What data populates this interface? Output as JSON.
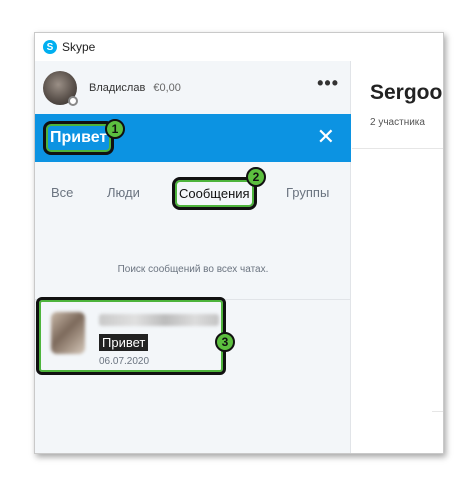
{
  "window": {
    "title": "Skype",
    "logo_letter": "S"
  },
  "profile": {
    "name": "Владислав",
    "balance": "€0,00",
    "more": "•••"
  },
  "search": {
    "query": "Привет",
    "close": "✕"
  },
  "tabs": [
    {
      "label": "Все"
    },
    {
      "label": "Люди"
    },
    {
      "label": "Сообщения"
    },
    {
      "label": "Группы"
    }
  ],
  "hint": "Поиск сообщений во всех чатах.",
  "result": {
    "snippet": "Привет",
    "date": "06.07.2020"
  },
  "badges": [
    "1",
    "2",
    "3"
  ],
  "chat": {
    "title": "Sergoo",
    "subtitle": "2 участника"
  }
}
